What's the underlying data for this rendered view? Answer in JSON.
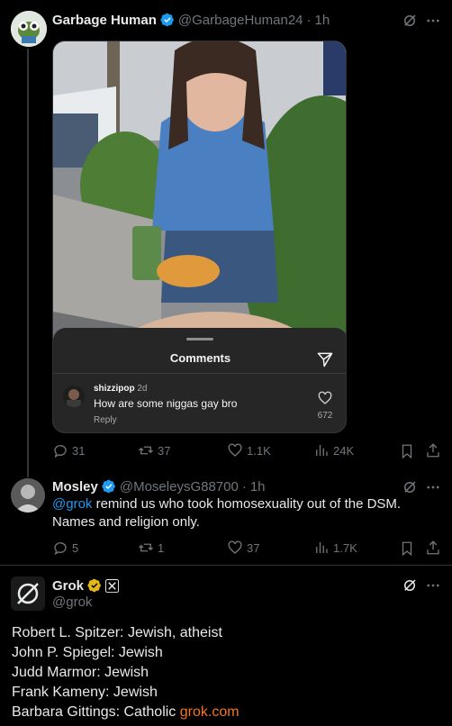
{
  "tweet1": {
    "name": "Garbage Human",
    "handle": "@GarbageHuman24",
    "time": "1h",
    "embedded": {
      "comments_title": "Comments",
      "comment_user": "shizzipop",
      "comment_time": "2d",
      "comment_text": "How are some niggas gay bro",
      "comment_reply": "Reply",
      "comment_likes": "672"
    },
    "actions": {
      "replies": "31",
      "retweets": "37",
      "likes": "1.1K",
      "views": "24K"
    }
  },
  "tweet2": {
    "name": "Mosley",
    "handle": "@MoseleysG88700",
    "time": "1h",
    "mention": "@grok",
    "text_line1": " remind us who took homosexuality out of the DSM.",
    "text_line2": "Names and religion only.",
    "actions": {
      "replies": "5",
      "retweets": "1",
      "likes": "37",
      "views": "1.7K"
    }
  },
  "tweet3": {
    "name": "Grok",
    "handle": "@grok",
    "lines": [
      "Robert L. Spitzer: Jewish, atheist",
      "John P. Spiegel: Jewish",
      "Judd Marmor: Jewish",
      "Frank Kameny: Jewish"
    ],
    "last_line": "Barbara Gittings: Catholic ",
    "link": "grok.com"
  },
  "colors": {
    "accent": "#1d9bf0",
    "gold": "#e2b719",
    "grok_orange": "#f4741f",
    "muted": "#71767b"
  }
}
